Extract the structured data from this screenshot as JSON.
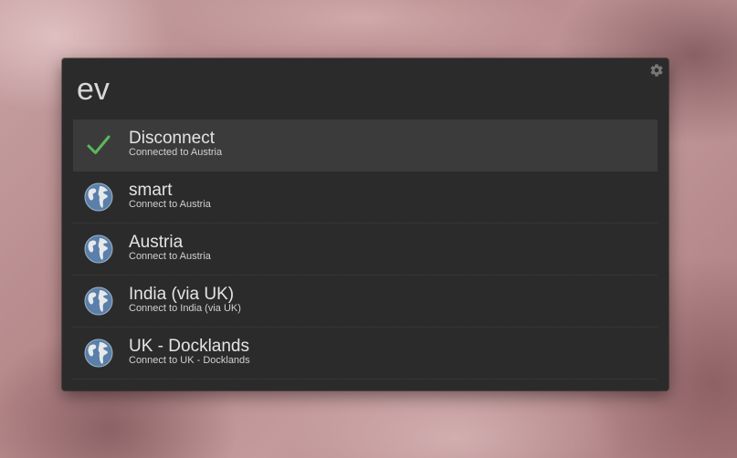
{
  "search": {
    "query": "ev"
  },
  "settings": {
    "icon": "gear-icon"
  },
  "results": [
    {
      "title": "Disconnect",
      "description": "Connected to Austria",
      "icon": "checkmark-icon",
      "selected": true
    },
    {
      "title": "smart",
      "description": "Connect to Austria",
      "icon": "globe-icon",
      "selected": false
    },
    {
      "title": "Austria",
      "description": "Connect to Austria",
      "icon": "globe-icon",
      "selected": false
    },
    {
      "title": "India (via UK)",
      "description": "Connect to India (via UK)",
      "icon": "globe-icon",
      "selected": false
    },
    {
      "title": "UK - Docklands",
      "description": "Connect to UK - Docklands",
      "icon": "globe-icon",
      "selected": false
    }
  ],
  "colors": {
    "panel": "#2b2b2b",
    "selected_row": "#3b3b3b",
    "check": "#5cb85c",
    "globe_ocean": "#5a7fa8",
    "globe_land": "#e6e9ec"
  }
}
